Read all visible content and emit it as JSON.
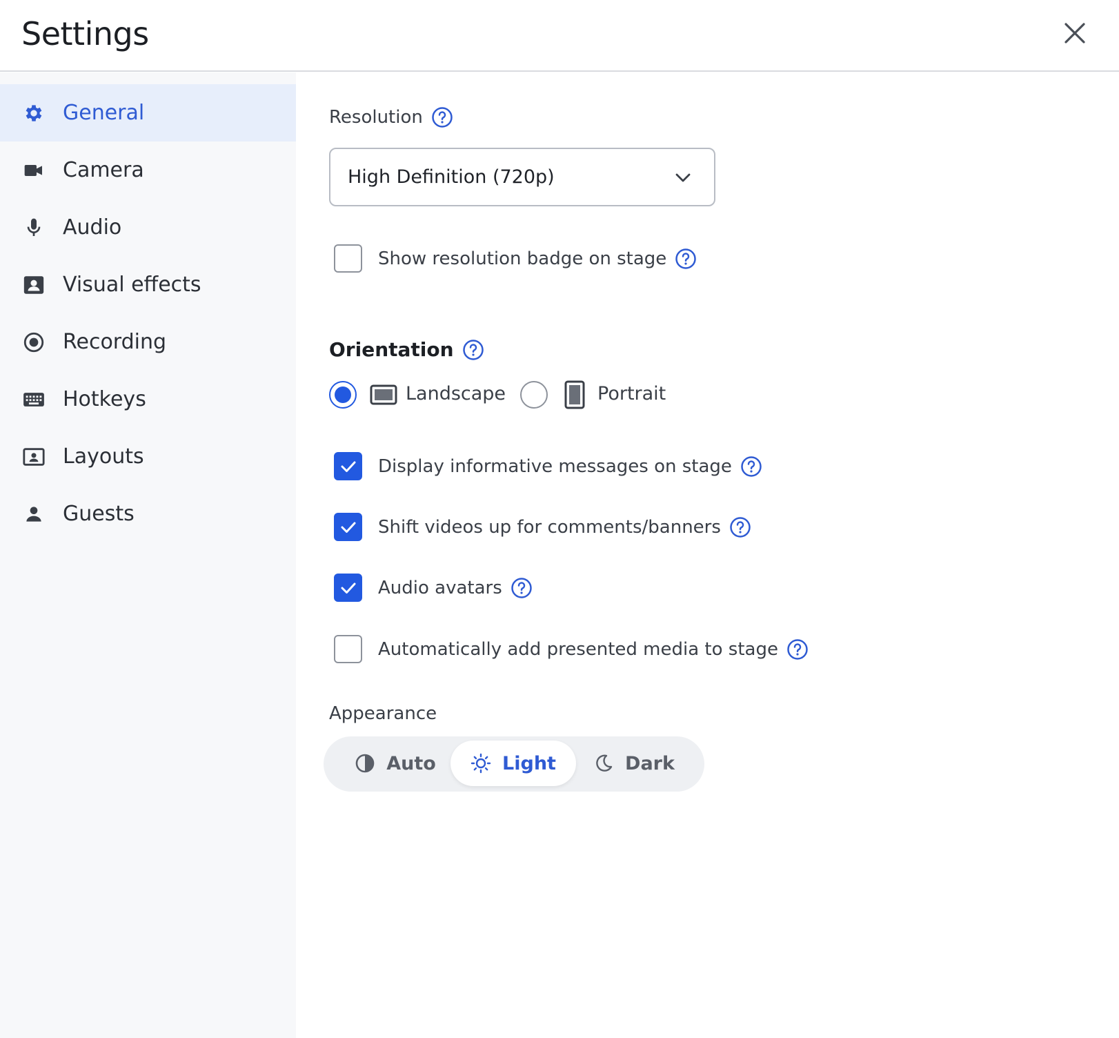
{
  "header": {
    "title": "Settings"
  },
  "sidebar": {
    "items": [
      {
        "label": "General",
        "icon": "gear-icon",
        "active": true
      },
      {
        "label": "Camera",
        "icon": "camera-icon",
        "active": false
      },
      {
        "label": "Audio",
        "icon": "microphone-icon",
        "active": false
      },
      {
        "label": "Visual effects",
        "icon": "person-card-icon",
        "active": false
      },
      {
        "label": "Recording",
        "icon": "record-icon",
        "active": false
      },
      {
        "label": "Hotkeys",
        "icon": "keyboard-icon",
        "active": false
      },
      {
        "label": "Layouts",
        "icon": "layout-icon",
        "active": false
      },
      {
        "label": "Guests",
        "icon": "person-icon",
        "active": false
      }
    ]
  },
  "general": {
    "resolution_label": "Resolution",
    "resolution_value": "High Definition (720p)",
    "show_badge": {
      "label": "Show resolution badge on stage",
      "checked": false
    },
    "orientation": {
      "title": "Orientation",
      "landscape_label": "Landscape",
      "portrait_label": "Portrait",
      "selected": "Landscape"
    },
    "options": [
      {
        "label": "Display informative messages on stage",
        "checked": true
      },
      {
        "label": "Shift videos up for comments/banners",
        "checked": true
      },
      {
        "label": "Audio avatars",
        "checked": true
      },
      {
        "label": "Automatically add presented media to stage",
        "checked": false
      }
    ],
    "appearance": {
      "label": "Appearance",
      "auto_label": "Auto",
      "light_label": "Light",
      "dark_label": "Dark",
      "selected": "Light"
    }
  },
  "colors": {
    "accent": "#2259e0",
    "active_nav_bg": "#e7eefb",
    "sidebar_bg": "#f7f8fa"
  }
}
